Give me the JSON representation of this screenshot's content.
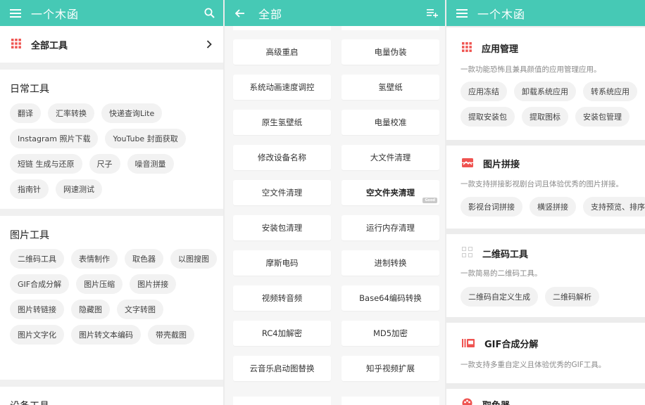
{
  "theme": {
    "primary": "#46c9b5",
    "chip_bg": "#f2f2f2",
    "icon_red": "#ef5350"
  },
  "panel1": {
    "appbar": {
      "title": "一个木函",
      "menu_icon": "menu-icon",
      "search_icon": "search-icon"
    },
    "all_tools": {
      "label": "全部工具",
      "icon": "grid-icon",
      "chevron": "chevron-right-icon"
    },
    "sections": [
      {
        "title": "日常工具",
        "chips": [
          "翻译",
          "汇率转换",
          "快递查询Lite",
          "Instagram 照片下载",
          "YouTube 封面获取",
          "短链 生成与还原",
          "尺子",
          "噪音测量",
          "指南针",
          "网速测试"
        ]
      },
      {
        "title": "图片工具",
        "chips": [
          "二维码工具",
          "表情制作",
          "取色器",
          "以图搜图",
          "GIF合成分解",
          "图片压缩",
          "图片拼接",
          "图片转链接",
          "隐藏图",
          "文字转图",
          "图片文字化",
          "图片转文本编码",
          "带壳截图"
        ]
      },
      {
        "title": "设备工具",
        "chips": []
      }
    ]
  },
  "panel2": {
    "appbar": {
      "title": "全部",
      "back_icon": "arrow-left-icon",
      "sort_icon": "playlist-add-icon"
    },
    "tiles": [
      {
        "label": "高级重启"
      },
      {
        "label": "电量伪装"
      },
      {
        "label": "系统动画速度调控"
      },
      {
        "label": "氢壁纸"
      },
      {
        "label": "原生氢壁纸"
      },
      {
        "label": "电量校准"
      },
      {
        "label": "修改设备名称"
      },
      {
        "label": "大文件清理"
      },
      {
        "label": "空文件清理"
      },
      {
        "label": "空文件夹清理",
        "tag": "Good"
      },
      {
        "label": "安装包清理"
      },
      {
        "label": "运行内存清理"
      },
      {
        "label": "摩斯电码"
      },
      {
        "label": "进制转换"
      },
      {
        "label": "视频转音频"
      },
      {
        "label": "Base64编码转换"
      },
      {
        "label": "RC4加解密"
      },
      {
        "label": "MD5加密"
      },
      {
        "label": "云音乐启动图替换"
      },
      {
        "label": "知乎视频扩展"
      }
    ]
  },
  "panel3": {
    "appbar": {
      "title": "一个木函",
      "menu_icon": "menu-icon"
    },
    "cards": [
      {
        "name": "应用管理",
        "icon": "apps-grid-icon",
        "desc": "一款功能恐怖且兼具颜值的应用管理应用。",
        "chips": [
          "应用冻结",
          "卸载系统应用",
          "转系统应用"
        ],
        "chips2": [
          "提取安装包",
          "提取图标",
          "安装包管理"
        ]
      },
      {
        "name": "图片拼接",
        "icon": "image-collage-icon",
        "desc": "一款支持拼接影视剧台词且体验优秀的图片拼接。",
        "chips": [
          "影视台词拼接",
          "横竖拼接",
          "支持预览、排序"
        ],
        "chips2": []
      },
      {
        "name": "二维码工具",
        "icon": "qr-code-icon",
        "desc": "一款简易的二维码工具。",
        "chips": [
          "二维码自定义生成",
          "二维码解析"
        ],
        "chips2": []
      },
      {
        "name": "GIF合成分解",
        "icon": "gif-icon",
        "desc": "一款支持多重自定义且体验优秀的GIF工具。",
        "chips": [],
        "chips2": []
      },
      {
        "name": "取色器",
        "icon": "palette-icon",
        "desc": "",
        "chips": [],
        "chips2": []
      }
    ]
  }
}
